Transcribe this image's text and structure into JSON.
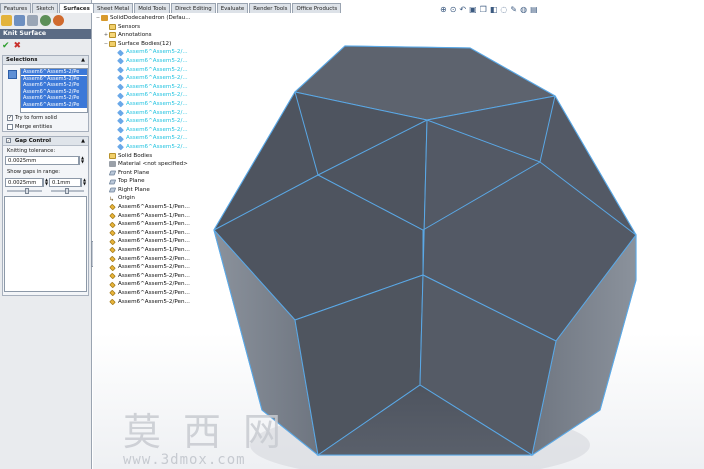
{
  "command_tabs_left": [
    {
      "label": "Features",
      "active": false
    },
    {
      "label": "Sketch",
      "active": false
    },
    {
      "label": "Surfaces",
      "active": true
    }
  ],
  "command_tabs_right": [
    {
      "label": "Sheet Metal"
    },
    {
      "label": "Mold Tools"
    },
    {
      "label": "Direct Editing"
    },
    {
      "label": "Evaluate"
    },
    {
      "label": "Render Tools"
    },
    {
      "label": "Office Products"
    }
  ],
  "property_manager": {
    "title": "Knit Surface",
    "ok_icon": "✔",
    "cancel_icon": "✖",
    "selections": {
      "header": "Selections",
      "items": [
        "Assem6^Assem5-2/Pe",
        "Assem6^Assem5-2/Pe",
        "Assem6^Assem5-2/Pe",
        "Assem6^Assem5-2/Pe",
        "Assem6^Assem5-2/Pe",
        "Assem6^Assem5-2/Pe"
      ],
      "try_form_solid": "Try to form solid",
      "try_form_solid_checked": true,
      "merge_entities": "Merge entities",
      "merge_entities_checked": false
    },
    "gap_control": {
      "header": "Gap Control",
      "knitting_tolerance_label": "Knitting tolerance:",
      "knitting_tolerance_value": "0.0025mm",
      "show_gaps_label": "Show gaps in range:",
      "gap_min": "0.0025mm",
      "gap_max": "0.1mm"
    }
  },
  "feature_tree": {
    "root": "SolidDodecahedron  (Defau...",
    "items": [
      {
        "label": "Sensors",
        "icon": "fold",
        "indent": 1,
        "toggle": ""
      },
      {
        "label": "Annotations",
        "icon": "ann",
        "indent": 1,
        "toggle": "+"
      },
      {
        "label": "Surface Bodies(12)",
        "icon": "fold",
        "indent": 1,
        "toggle": "−"
      },
      {
        "label": "Assem6^Assem5-2/...",
        "icon": "surf",
        "indent": 2,
        "toggle": "",
        "cyan": true
      },
      {
        "label": "Assem6^Assem5-2/...",
        "icon": "surf",
        "indent": 2,
        "toggle": "",
        "cyan": true
      },
      {
        "label": "Assem6^Assem5-2/...",
        "icon": "surf",
        "indent": 2,
        "toggle": "",
        "cyan": true
      },
      {
        "label": "Assem6^Assem5-2/...",
        "icon": "surf",
        "indent": 2,
        "toggle": "",
        "cyan": true
      },
      {
        "label": "Assem6^Assem5-2/...",
        "icon": "surf",
        "indent": 2,
        "toggle": "",
        "cyan": true
      },
      {
        "label": "Assem6^Assem5-2/...",
        "icon": "surf",
        "indent": 2,
        "toggle": "",
        "cyan": true
      },
      {
        "label": "Assem6^Assem5-2/...",
        "icon": "surf",
        "indent": 2,
        "toggle": "",
        "cyan": true
      },
      {
        "label": "Assem6^Assem5-2/...",
        "icon": "surf",
        "indent": 2,
        "toggle": "",
        "cyan": true
      },
      {
        "label": "Assem6^Assem5-2/...",
        "icon": "surf",
        "indent": 2,
        "toggle": "",
        "cyan": true
      },
      {
        "label": "Assem6^Assem5-2/...",
        "icon": "surf",
        "indent": 2,
        "toggle": "",
        "cyan": true
      },
      {
        "label": "Assem6^Assem5-2/...",
        "icon": "surf",
        "indent": 2,
        "toggle": "",
        "cyan": true
      },
      {
        "label": "Assem6^Assem5-2/...",
        "icon": "surf",
        "indent": 2,
        "toggle": "",
        "cyan": true
      },
      {
        "label": "Solid Bodies",
        "icon": "fold",
        "indent": 1,
        "toggle": ""
      },
      {
        "label": "Material <not specified>",
        "icon": "mat",
        "indent": 1,
        "toggle": ""
      },
      {
        "label": "Front Plane",
        "icon": "plane",
        "indent": 1,
        "toggle": ""
      },
      {
        "label": "Top Plane",
        "icon": "plane",
        "indent": 1,
        "toggle": ""
      },
      {
        "label": "Right Plane",
        "icon": "plane",
        "indent": 1,
        "toggle": ""
      },
      {
        "label": "Origin",
        "icon": "orig",
        "indent": 1,
        "toggle": ""
      },
      {
        "label": "Assem6^Assem5-1/Pen...",
        "icon": "feat",
        "indent": 1,
        "toggle": ""
      },
      {
        "label": "Assem6^Assem5-1/Pen...",
        "icon": "feat",
        "indent": 1,
        "toggle": ""
      },
      {
        "label": "Assem6^Assem5-1/Pen...",
        "icon": "feat",
        "indent": 1,
        "toggle": ""
      },
      {
        "label": "Assem6^Assem5-1/Pen...",
        "icon": "feat",
        "indent": 1,
        "toggle": ""
      },
      {
        "label": "Assem6^Assem5-1/Pen...",
        "icon": "feat",
        "indent": 1,
        "toggle": ""
      },
      {
        "label": "Assem6^Assem5-1/Pen...",
        "icon": "feat",
        "indent": 1,
        "toggle": ""
      },
      {
        "label": "Assem6^Assem5-2/Pen...",
        "icon": "feat",
        "indent": 1,
        "toggle": ""
      },
      {
        "label": "Assem6^Assem5-2/Pen...",
        "icon": "feat",
        "indent": 1,
        "toggle": ""
      },
      {
        "label": "Assem6^Assem5-2/Pen...",
        "icon": "feat",
        "indent": 1,
        "toggle": ""
      },
      {
        "label": "Assem6^Assem5-2/Pen...",
        "icon": "feat",
        "indent": 1,
        "toggle": ""
      },
      {
        "label": "Assem6^Assem5-2/Pen...",
        "icon": "feat",
        "indent": 1,
        "toggle": ""
      },
      {
        "label": "Assem6^Assem5-2/Pen...",
        "icon": "feat",
        "indent": 1,
        "toggle": ""
      }
    ]
  },
  "view_toolbar_icons": [
    "zoom-to-fit-icon",
    "zoom-area-icon",
    "previous-view-icon",
    "section-view-icon",
    "view-orientation-icon",
    "display-style-icon",
    "hide-show-icon",
    "edit-appearance-icon",
    "scene-icon",
    "view-settings-icon"
  ],
  "watermark": {
    "text": "莫西网",
    "url": "www.3dmox.com"
  },
  "colors": {
    "face": "#545a66",
    "edge": "#5aa8e6",
    "panel": "#e9ebee",
    "accent": "#3b78d8"
  }
}
